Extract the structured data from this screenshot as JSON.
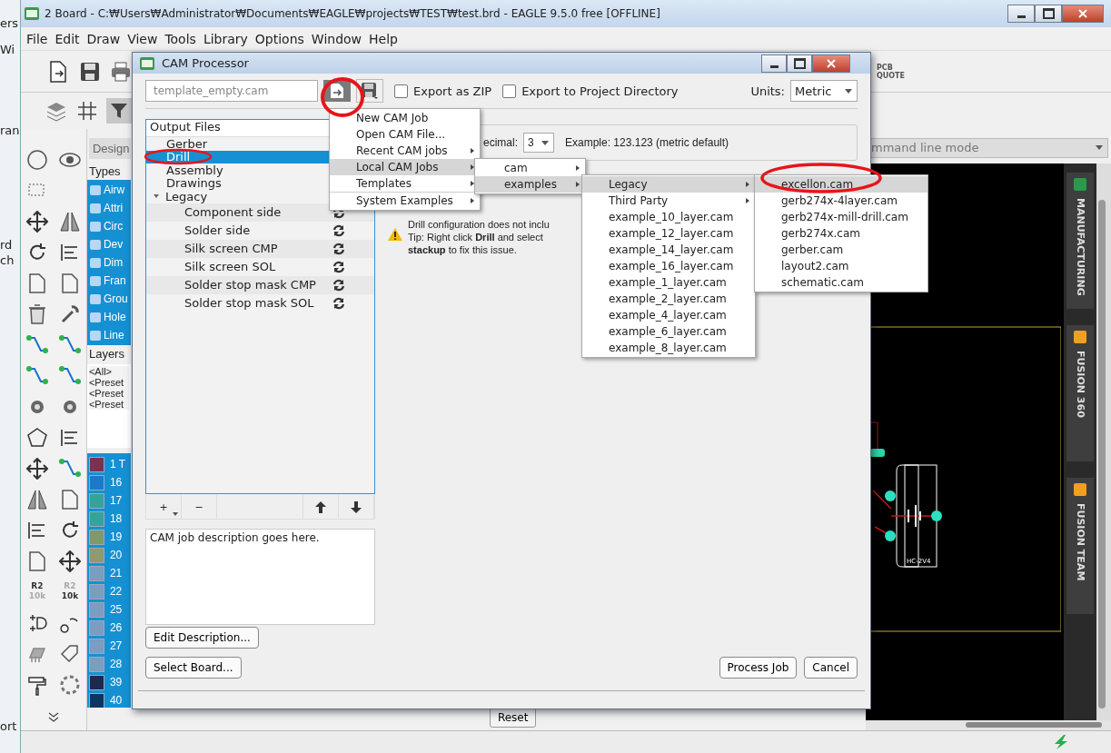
{
  "background_window": {
    "fragments": [
      "ers",
      "Wi",
      "ran",
      "rd",
      "ch",
      "ort"
    ]
  },
  "main_window": {
    "title": "2 Board - C:₩Users₩Administrator₩Documents₩EAGLE₩projects₩TEST₩test.brd - EAGLE 9.5.0 free [OFFLINE]",
    "menu": [
      "File",
      "Edit",
      "Draw",
      "View",
      "Tools",
      "Library",
      "Options",
      "Window",
      "Help"
    ],
    "quote_button": [
      "PCB",
      "QUOTE"
    ],
    "value_icons": [
      {
        "kind": "name",
        "top": "R2",
        "bottom": "10k"
      },
      {
        "kind": "value",
        "top": "R2",
        "bottom": "10k"
      }
    ],
    "panel_tab": "Design",
    "types_heading": "Types",
    "types": [
      "Airw",
      "Attri",
      "Circ",
      "Dev",
      "Dim",
      "Fran",
      "Grou",
      "Hole",
      "Line"
    ],
    "layers_heading": "Layers",
    "layer_presets": [
      "<All>",
      "<Preset",
      "<Preset",
      "<Preset"
    ],
    "layers": [
      {
        "label": "1 T",
        "color": "#7d3050"
      },
      {
        "label": "16",
        "color": "#1a7ac8"
      },
      {
        "label": "17",
        "color": "#36a39a"
      },
      {
        "label": "18",
        "color": "#36a39a"
      },
      {
        "label": "19",
        "color": "#7e9a6a"
      },
      {
        "label": "20",
        "color": "#8f9a6e"
      },
      {
        "label": "21",
        "color": "#7c9cc0"
      },
      {
        "label": "22",
        "color": "#7c9cc0"
      },
      {
        "label": "25",
        "color": "#7c9cc0"
      },
      {
        "label": "26",
        "color": "#7c9cc0"
      },
      {
        "label": "27",
        "color": "#7c9cc0"
      },
      {
        "label": "28",
        "color": "#7c9cc0"
      },
      {
        "label": "39",
        "color": "#1c2a50"
      },
      {
        "label": "40",
        "color": "#0c3563"
      }
    ],
    "command_line": {
      "value": "mmand line mode"
    },
    "part_label": "HC-2V4",
    "side_tabs": [
      "MANUFACTURING",
      "FUSION 360",
      "FUSION TEAM"
    ],
    "reset_button": "Reset"
  },
  "cam_dialog": {
    "title": "CAM Processor",
    "job_file": {
      "placeholder": "template_empty.cam"
    },
    "export_zip": {
      "label": "Export as ZIP",
      "checked": false
    },
    "export_project": {
      "label": "Export to Project Directory",
      "checked": false
    },
    "units_label": "Units:",
    "units": "Metric",
    "output_files": {
      "heading": "Output Files",
      "items": [
        {
          "label": "Gerber",
          "selected": false
        },
        {
          "label": "Drill",
          "selected": true
        },
        {
          "label": "Assembly",
          "selected": false
        },
        {
          "label": "Drawings",
          "selected": false
        },
        {
          "label": "Legacy",
          "selected": false,
          "expanded": true,
          "children": [
            {
              "label": "Component side",
              "selected": false
            },
            {
              "label": "Solder side",
              "selected": false
            },
            {
              "label": "Silk screen CMP",
              "selected": false
            },
            {
              "label": "Silk screen SOL",
              "selected": false
            },
            {
              "label": "Solder stop mask CMP",
              "selected": false
            },
            {
              "label": "Solder stop mask SOL",
              "selected": false
            }
          ]
        }
      ]
    },
    "list_tools": [
      "+",
      "−"
    ],
    "decimal_label": "ecimal:",
    "decimal": "3",
    "example": "Example: 123.123 (metric default)",
    "warning_lines": [
      "Drill configuration does not inclu",
      "Tip: Right click **Drill** and select",
      "**stackup** to fix this issue."
    ],
    "description": "CAM job description goes here.",
    "edit_description_button": "Edit Description...",
    "select_board_button": "Select Board...",
    "process_button": "Process Job",
    "cancel_button": "Cancel"
  },
  "menus": [
    {
      "items": [
        {
          "label": "New CAM Job",
          "submenu": false,
          "selected": false
        },
        {
          "label": "Open CAM File...",
          "submenu": false,
          "selected": false
        },
        {
          "label": "Recent CAM jobs",
          "submenu": true,
          "selected": false
        },
        {
          "label": "Local CAM Jobs",
          "submenu": true,
          "selected": true
        },
        {
          "label": "Templates",
          "submenu": true,
          "selected": false
        },
        {
          "label": "System Examples",
          "submenu": true,
          "selected": false
        }
      ]
    },
    {
      "items": [
        {
          "label": "cam",
          "submenu": true,
          "selected": false
        },
        {
          "label": "examples",
          "submenu": true,
          "selected": true
        }
      ]
    },
    {
      "items": [
        {
          "label": "Legacy",
          "submenu": true,
          "selected": true
        },
        {
          "label": "Third Party",
          "submenu": true,
          "selected": false
        },
        {
          "label": "example_10_layer.cam",
          "submenu": false,
          "selected": false
        },
        {
          "label": "example_12_layer.cam",
          "submenu": false,
          "selected": false
        },
        {
          "label": "example_14_layer.cam",
          "submenu": false,
          "selected": false
        },
        {
          "label": "example_16_layer.cam",
          "submenu": false,
          "selected": false
        },
        {
          "label": "example_1_layer.cam",
          "submenu": false,
          "selected": false
        },
        {
          "label": "example_2_layer.cam",
          "submenu": false,
          "selected": false
        },
        {
          "label": "example_4_layer.cam",
          "submenu": false,
          "selected": false
        },
        {
          "label": "example_6_layer.cam",
          "submenu": false,
          "selected": false
        },
        {
          "label": "example_8_layer.cam",
          "submenu": false,
          "selected": false
        }
      ]
    },
    {
      "items": [
        {
          "label": "excellon.cam",
          "submenu": false,
          "selected": true
        },
        {
          "label": "gerb274x-4layer.cam",
          "submenu": false,
          "selected": false
        },
        {
          "label": "gerb274x-mill-drill.cam",
          "submenu": false,
          "selected": false
        },
        {
          "label": "gerb274x.cam",
          "submenu": false,
          "selected": false
        },
        {
          "label": "gerber.cam",
          "submenu": false,
          "selected": false
        },
        {
          "label": "layout2.cam",
          "submenu": false,
          "selected": false
        },
        {
          "label": "schematic.cam",
          "submenu": false,
          "selected": false
        }
      ]
    }
  ]
}
